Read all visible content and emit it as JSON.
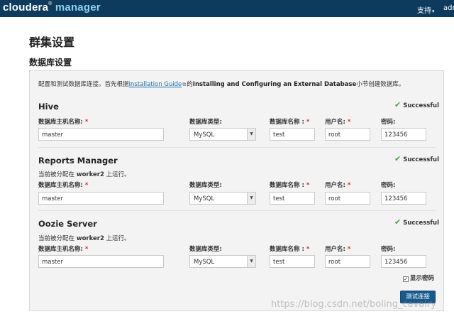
{
  "app": {
    "logo_brand": "cloudera",
    "logo_reg": "®",
    "logo_product": "manager",
    "nav_support": "支持",
    "nav_support_caret": "▾",
    "nav_user": "adm"
  },
  "page": {
    "title": "群集设置",
    "section_title": "数据库设置"
  },
  "intro": {
    "prefix": "配置和测试数据库连接。首先根据",
    "link": "Installation Guide",
    "middle": "的",
    "bold": "Installing and Configuring an External Database",
    "suffix": "小节创建数据库。"
  },
  "labels": {
    "host": "数据库主机名称:",
    "type": "数据库类型:",
    "dbname": "数据库名称 :",
    "user": "用户名:",
    "password": "密码:",
    "required": "*"
  },
  "status": {
    "check": "✔",
    "success_text": "Successful"
  },
  "runs_on": {
    "prefix": "当前被分配在",
    "host": "worker2",
    "suffix": "上运行。"
  },
  "databases": [
    {
      "title": "Hive",
      "host": "master",
      "type": "MySQL",
      "dbname": "test",
      "user": "root",
      "password": "123456"
    },
    {
      "title": "Reports Manager",
      "host": "master",
      "type": "MySQL",
      "dbname": "test",
      "user": "root",
      "password": "123456"
    },
    {
      "title": "Oozie Server",
      "host": "master",
      "type": "MySQL",
      "dbname": "test",
      "user": "root",
      "password": "123456"
    }
  ],
  "show_password": {
    "label": "显示密码",
    "checked": true,
    "mark": "✓"
  },
  "test_button": "测试连接",
  "watermark": "https://blog.csdn.net/boling_cavalry",
  "colors": {
    "topbar": "#0d3b5e",
    "button": "#145a8c",
    "success_check": "#4aa54a",
    "required": "#c9302c"
  }
}
